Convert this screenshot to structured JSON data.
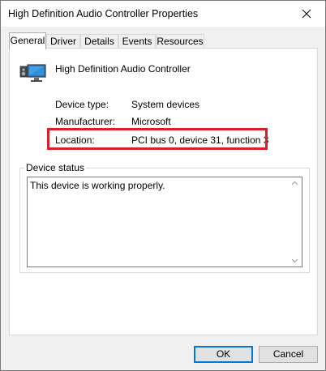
{
  "window": {
    "title": "High Definition Audio Controller Properties"
  },
  "tabs": [
    {
      "label": "General"
    },
    {
      "label": "Driver"
    },
    {
      "label": "Details"
    },
    {
      "label": "Events"
    },
    {
      "label": "Resources"
    }
  ],
  "device": {
    "name": "High Definition Audio Controller",
    "icon": "speaker-monitor-icon"
  },
  "properties": [
    {
      "label": "Device type:",
      "value": "System devices"
    },
    {
      "label": "Manufacturer:",
      "value": "Microsoft"
    },
    {
      "label": "Location:",
      "value": "PCI bus 0, device 31, function 3"
    }
  ],
  "device_status": {
    "legend": "Device status",
    "text": "This device is working properly."
  },
  "buttons": {
    "ok": "OK",
    "cancel": "Cancel"
  },
  "colors": {
    "highlight": "#d81f2a",
    "default_button_border": "#0078d7"
  }
}
